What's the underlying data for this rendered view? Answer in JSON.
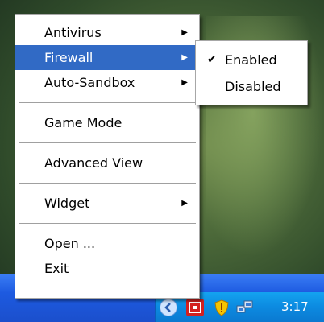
{
  "menu": {
    "items": [
      {
        "label": "Antivirus",
        "submenu": true
      },
      {
        "label": "Firewall",
        "submenu": true,
        "selected": true
      },
      {
        "label": "Auto-Sandbox",
        "submenu": true
      },
      {
        "label": "Game Mode"
      },
      {
        "label": "Advanced View"
      },
      {
        "label": "Widget",
        "submenu": true
      },
      {
        "label": "Open ..."
      },
      {
        "label": "Exit"
      }
    ]
  },
  "submenu": {
    "items": [
      {
        "label": "Enabled",
        "checked": true
      },
      {
        "label": "Disabled",
        "checked": false
      }
    ]
  },
  "taskbar": {
    "clock": "3:17",
    "tray_icons": [
      "chevron-icon",
      "comodo-icon",
      "security-shield-icon",
      "network-icon"
    ]
  },
  "colors": {
    "selection": "#316ac5",
    "taskbar": "#1d5ae0",
    "tray": "#0c8ae0"
  }
}
